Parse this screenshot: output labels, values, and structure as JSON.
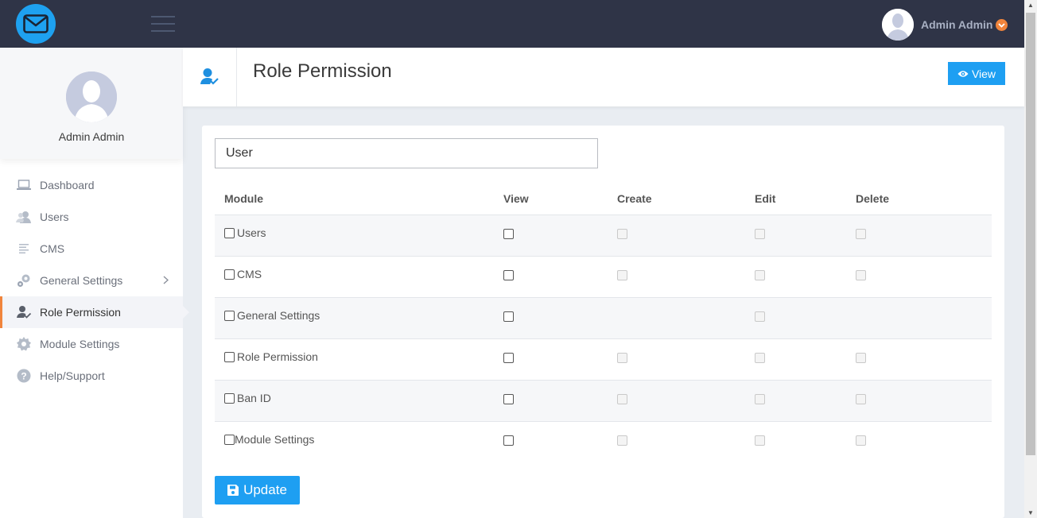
{
  "topbar": {
    "user_name": "Admin Admin",
    "accent_color": "#f0843c",
    "brand_color": "#1ea1f0",
    "logo_icon": "mail-icon"
  },
  "sidebar": {
    "profile_name": "Admin Admin",
    "items": [
      {
        "label": "Dashboard",
        "icon": "laptop-icon"
      },
      {
        "label": "Users",
        "icon": "users-icon"
      },
      {
        "label": "CMS",
        "icon": "document-lines-icon"
      },
      {
        "label": "General Settings",
        "icon": "gears-icon"
      },
      {
        "label": "Role Permission",
        "icon": "user-check-icon"
      },
      {
        "label": "Module Settings",
        "icon": "gear-icon"
      },
      {
        "label": "Help/Support",
        "icon": "question-icon"
      }
    ],
    "active": "Role Permission"
  },
  "header": {
    "title": "Role Permission",
    "view_label": "View"
  },
  "form": {
    "role_value": "User",
    "columns": [
      "Module",
      "View",
      "Create",
      "Edit",
      "Delete"
    ],
    "rows": [
      {
        "module": "Users",
        "view": true,
        "create": true,
        "edit": true,
        "delete": true
      },
      {
        "module": "CMS",
        "view": true,
        "create": true,
        "edit": true,
        "delete": true
      },
      {
        "module": "General Settings",
        "view": true,
        "create": false,
        "edit": true,
        "delete": false
      },
      {
        "module": "Role Permission",
        "view": true,
        "create": true,
        "edit": true,
        "delete": true
      },
      {
        "module": "Ban ID",
        "view": true,
        "create": true,
        "edit": true,
        "delete": true
      },
      {
        "module": "Module Settings",
        "view": true,
        "create": true,
        "edit": true,
        "delete": true
      }
    ],
    "update_label": "Update"
  }
}
